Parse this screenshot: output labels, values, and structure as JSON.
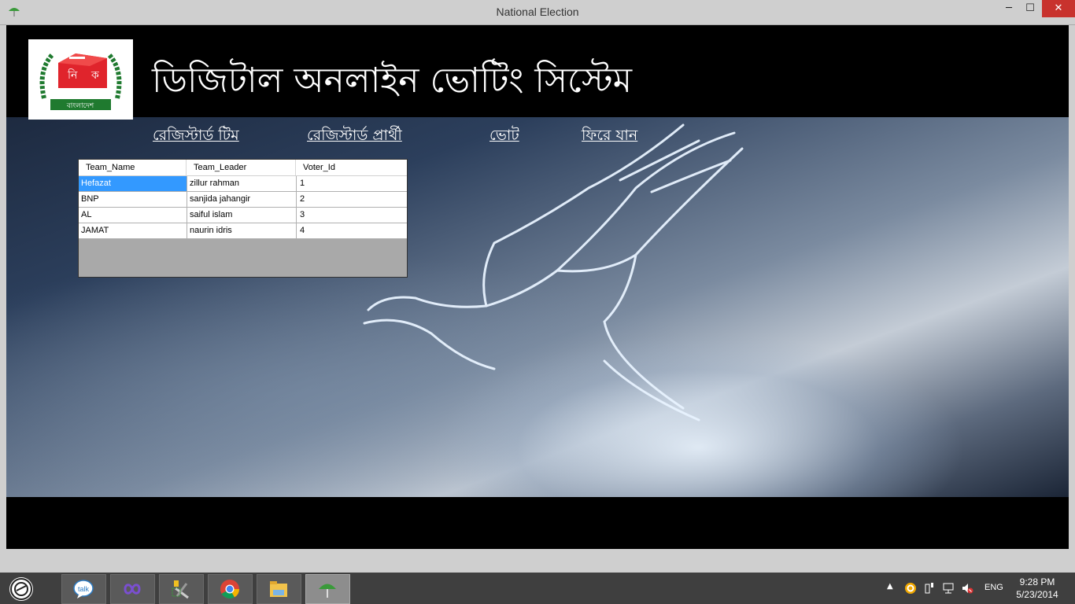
{
  "window": {
    "title": "National Election",
    "minimize": "─",
    "maximize": "☐",
    "close": "✕"
  },
  "header": {
    "heading": "ডিজিটাল অনলাইন ভোটিং সিস্টেম",
    "logo_text": "বাংলাদেশ",
    "logo_letters": [
      "নি",
      "ক"
    ]
  },
  "nav": {
    "registered_team": "রেজিস্টার্ড টিম",
    "registered_candidate": "রেজিস্টার্ড প্রার্থী",
    "vote": "ভোট",
    "go_back": "ফিরে যান"
  },
  "grid": {
    "columns": [
      "Team_Name",
      "Team_Leader",
      "Voter_Id"
    ],
    "rows": [
      [
        "Hefazat",
        "zillur rahman",
        "1"
      ],
      [
        "BNP",
        "sanjida jahangir",
        "2"
      ],
      [
        "AL",
        "saiful islam",
        "3"
      ],
      [
        "JAMAT",
        "naurin idris",
        "4"
      ]
    ],
    "selected_row": 0
  },
  "taskbar": {
    "items": [
      "talk-icon",
      "infinity-icon",
      "tools-icon",
      "chrome-icon",
      "file-explorer-icon",
      "election-app-icon"
    ],
    "talk_label": "talk",
    "language": "ENG",
    "time": "9:28 PM",
    "date": "5/23/2014",
    "tray_arrow": "▲"
  },
  "colors": {
    "selection": "#3399ff",
    "close_button": "#c8322d",
    "logo_red": "#e0242c",
    "logo_green": "#1f7a2f"
  }
}
